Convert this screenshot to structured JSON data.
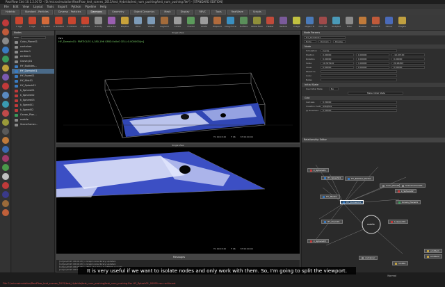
{
  "window": {
    "title": "RealFlow Cdd 10.1.2.0172 - [D:/microsimulation/RealFlow_test_scenes_2015/test_Hybrido/test_num_pushing/test_num_pushing.flw*] - [STANDARD EDITION]"
  },
  "menu": [
    "File",
    "Edit",
    "View",
    "Layout",
    "Tools",
    "Export",
    "Python",
    "Pipeline",
    "Help"
  ],
  "tabs": [
    {
      "label": "Hybrido"
    },
    {
      "label": "Standard - Particles"
    },
    {
      "label": "Dyverso - Particles"
    },
    {
      "label": "Daemons",
      "active": true
    },
    {
      "label": "Geometry"
    },
    {
      "label": "Object Dynamics"
    },
    {
      "label": "Mesh"
    },
    {
      "label": "Display"
    },
    {
      "label": "RBVC"
    },
    {
      "label": "Tools"
    },
    {
      "label": "RealWave"
    },
    {
      "label": "Scripts"
    }
  ],
  "toolbar": [
    {
      "label": "k Age",
      "color": "#c9452f"
    },
    {
      "label": "k Age",
      "color": "#c9452f"
    },
    {
      "label": "k Speed",
      "color": "#d46a3a"
    },
    {
      "label": "k Isolated",
      "color": "#c9452f"
    },
    {
      "label": "k Collision",
      "color": "#c9452f"
    },
    {
      "label": "k Sphere",
      "color": "#c9452f"
    },
    {
      "label": "Gravity",
      "color": "#8c8c8c"
    },
    {
      "label": "Attractor",
      "color": "#9a5fb0"
    },
    {
      "label": "DSpline",
      "color": "#c8a23a"
    },
    {
      "label": "Wind",
      "color": "#7d9bb8"
    },
    {
      "label": "Vortex",
      "color": "#7d9bb8"
    },
    {
      "label": "Lagrand",
      "color": "#a36b3a"
    },
    {
      "label": "Limits",
      "color": "#9c9c9c"
    },
    {
      "label": "Fractal",
      "color": "#5c9b5c"
    },
    {
      "label": "Limits",
      "color": "#9c9c9c"
    },
    {
      "label": "Ellipsoid",
      "color": "#b06a3c"
    },
    {
      "label": "Drag Force",
      "color": "#3a8fc0"
    },
    {
      "label": "Surface",
      "color": "#5a8f5a"
    },
    {
      "label": "Noise Field",
      "color": "#8f8f3a"
    },
    {
      "label": "Heater",
      "color": "#c04a3a"
    },
    {
      "label": "Texture",
      "color": "#7a5a9a"
    },
    {
      "label": "Image",
      "color": "#c0c040"
    },
    {
      "label": "Object Tr.",
      "color": "#4a7ab8"
    },
    {
      "label": "Coll. Vfx",
      "color": "#a04a4a"
    },
    {
      "label": "Sculpted",
      "color": "#4a9ab8"
    },
    {
      "label": "Filter",
      "color": "#8a8a8a"
    },
    {
      "label": "Breaker",
      "color": "#c07a3a"
    },
    {
      "label": "Global F.",
      "color": "#c05a3a"
    },
    {
      "label": "Cloner",
      "color": "#4a6ab8"
    },
    {
      "label": "Plugins",
      "color": "#c0a040"
    }
  ],
  "left_tools": [
    "#c03a3a",
    "#c05a3a",
    "#8a8a8a",
    "#3a7ac0",
    "#3a9a5a",
    "#c0a03a",
    "#7a5ab0",
    "#c03a3a",
    "#5a8ac0",
    "#3a9ab0",
    "#c04a4a",
    "#9a9a3a",
    "#5a5a5a",
    "#c07a3a",
    "#3a6ab0",
    "#a03a6a",
    "#4a9a4a",
    "#c0c0c0",
    "#c03a3a",
    "#3a3a8a",
    "#9a6a3a",
    "#c0603a"
  ],
  "nodes_panel": {
    "title": "Nodes",
    "filter_label": "Filter",
    "items": [
      {
        "label": "Color_Plane01",
        "color": "#8a8a8a"
      },
      {
        "label": "container",
        "color": "#8a8a8a"
      },
      {
        "label": "emitter1",
        "color": "#8a8a8a"
      },
      {
        "label": "emitter1",
        "color": "#8a8a8a"
      },
      {
        "label": "Gravity01",
        "color": "#8a8a8a"
      },
      {
        "label": "HY_Bubbles...",
        "color": "#3a7ac0"
      },
      {
        "label": "HY_Domain01",
        "color": "#3a7ac0",
        "selected": true
      },
      {
        "label": "HY_Foam01",
        "color": "#3a7ac0"
      },
      {
        "label": "HY_Mist01",
        "color": "#3a7ac0"
      },
      {
        "label": "HY_Splash01",
        "color": "#3a7ac0"
      },
      {
        "label": "k_Sphere01",
        "color": "#c03a3a"
      },
      {
        "label": "k_Sphere02",
        "color": "#c03a3a"
      },
      {
        "label": "k_Sphere03",
        "color": "#c03a3a"
      },
      {
        "label": "k_Speed01",
        "color": "#c03a3a"
      },
      {
        "label": "k_Speed02",
        "color": "#c03a3a"
      },
      {
        "label": "Ocean_Plan...",
        "color": "#3a9a5a"
      },
      {
        "label": "mobile",
        "color": "#8a8a8a"
      },
      {
        "label": "SceneCamer...",
        "color": "#8a8a8a"
      }
    ]
  },
  "viewport_top": {
    "title": "Single View",
    "mode": "Pers",
    "info": "HY_Domain01: PARTICLES 4,180,196 GRID:0x0x0 CELL:0.000000[m]",
    "tc": "TC 00:03:20",
    "frame": "F 96",
    "time": "ST 00:00:00"
  },
  "viewport_bottom": {
    "title": "Single View",
    "tc": "TC 00:03:20",
    "frame": "F 96",
    "time": "ST 00:00:00"
  },
  "phoenix": {
    "title": "Messages",
    "lines": [
      "[12/Jan/2015 08:06:43] > Graph node library updated.",
      "[12/Jan/2015 08:06:43] > Graph node library updated.",
      "[12/Jan/2015 08:06:43] > Total step time: 0.233023 seconds",
      "[12/Jan/2015 08:06:43] > Total step time: 0.351433 seconds"
    ]
  },
  "node_params": {
    "title": "Node Params",
    "node_name": "HY_Domain01",
    "subtabs": [
      "Node",
      "Domain",
      "Display"
    ],
    "sections": {
      "node": "Node",
      "initial_state": "Initial State",
      "grid": "Grid"
    },
    "rows": [
      {
        "label": "Simulation",
        "value": "Cache"
      },
      {
        "label": "Position",
        "value": "0.00000",
        "v2": "0.00000",
        "v3": "-10.07100"
      },
      {
        "label": "Rotation",
        "value": "0.00000",
        "v2": "0.00000",
        "v3": "0.00000"
      },
      {
        "label": "Scale",
        "value": "19.325120",
        "v2": "1.00000",
        "v3": "20.96303"
      },
      {
        "label": "Shear",
        "value": "0.00000",
        "v2": "0.00000",
        "v3": "0.00000"
      },
      {
        "label": "Parent to",
        "value": ""
      },
      {
        "label": "Color",
        "value": ""
      },
      {
        "label": "Notes",
        "value": ""
      }
    ],
    "use_initial_state": "Use Initial State",
    "use_initial_value": "No",
    "make_initial_state": "Make Initial State",
    "grid_rows": [
      {
        "label": "Cell size",
        "value": "0.30000"
      },
      {
        "label": "Creation mode",
        "value": "Adaptive"
      },
      {
        "label": "@ threshold",
        "value": "0.30000"
      }
    ]
  },
  "relationship_editor": {
    "title": "Relationship Editor",
    "hub_label": "mobile",
    "nodes": [
      {
        "label": "Color_Plane01",
        "color": "#8a8a8a"
      },
      {
        "label": "SceneCamera01",
        "color": "#8a8a8a"
      },
      {
        "label": "k_Sphere01",
        "color": "#c03a3a"
      },
      {
        "label": "HY_Splash01",
        "color": "#3a7ac0"
      },
      {
        "label": "HY_Bubbles_Particl.",
        "color": "#3a7ac0"
      },
      {
        "label": "k_Sphere02",
        "color": "#c03a3a"
      },
      {
        "label": "HY_Mist01",
        "color": "#3a7ac0"
      },
      {
        "label": "HY_Domain01",
        "color": "#3a7ac0"
      },
      {
        "label": "Ocean_Plane01",
        "color": "#3a9a5a"
      },
      {
        "label": "HY_Foam01",
        "color": "#3a7ac0"
      },
      {
        "label": "k_Speed01",
        "color": "#c03a3a"
      },
      {
        "label": "k_Sphere03",
        "color": "#c03a3a"
      },
      {
        "label": "container",
        "color": "#8a8a8a"
      },
      {
        "label": "emitter1",
        "color": "#c0a040"
      },
      {
        "label": "emitter2",
        "color": "#c0a040"
      },
      {
        "label": "mobile",
        "color": "#c0a040"
      }
    ]
  },
  "status": {
    "caption": "It is very useful if we want to isolate nodes and only work with them. So, I'm going to split the viewport.",
    "error": "File C:/microsimulation/RealFlow_test_scenes_2015/test_Hybrido/test_num_pushing/test_num_pushing.flw: HY_Splash01_00095.rwc not found.",
    "mode": "Normal"
  }
}
